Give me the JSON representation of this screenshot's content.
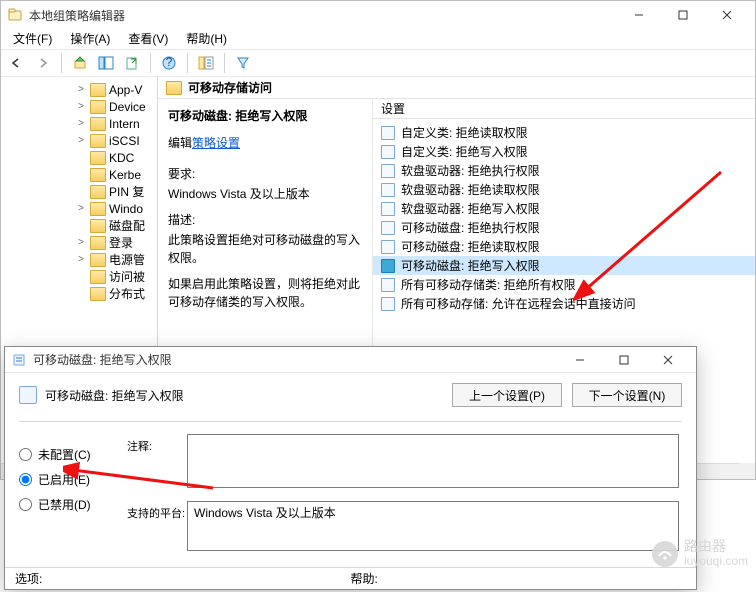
{
  "gpe": {
    "title": "本地组策略编辑器",
    "menu": {
      "file": "文件(F)",
      "action": "操作(A)",
      "view": "查看(V)",
      "help": "帮助(H)"
    },
    "tree": [
      {
        "label": "App-V",
        "caret": ">"
      },
      {
        "label": "Device",
        "caret": ">"
      },
      {
        "label": "Intern",
        "caret": ">"
      },
      {
        "label": "iSCSI",
        "caret": ">"
      },
      {
        "label": "KDC",
        "caret": ""
      },
      {
        "label": "Kerbe",
        "caret": ""
      },
      {
        "label": "PIN 复",
        "caret": ""
      },
      {
        "label": "Windo",
        "caret": ">"
      },
      {
        "label": "磁盘配",
        "caret": ""
      },
      {
        "label": "登录",
        "caret": ">"
      },
      {
        "label": "电源管",
        "caret": ">"
      },
      {
        "label": "访问被",
        "caret": ""
      },
      {
        "label": "分布式",
        "caret": ""
      }
    ],
    "detail": {
      "header": "可移动存储访问",
      "policy_name": "可移动磁盘: 拒绝写入权限",
      "edit_label": "编辑",
      "edit_link": "策略设置",
      "req_label": "要求:",
      "req_value": "Windows Vista 及以上版本",
      "desc_label": "描述:",
      "desc_value": "此策略设置拒绝对可移动磁盘的写入权限。",
      "desc_extra": "如果启用此策略设置，则将拒绝对此可移动存储类的写入权限。",
      "settings_head": "设置",
      "items": [
        {
          "label": "自定义类: 拒绝读取权限"
        },
        {
          "label": "自定义类: 拒绝写入权限"
        },
        {
          "label": "软盘驱动器: 拒绝执行权限"
        },
        {
          "label": "软盘驱动器: 拒绝读取权限"
        },
        {
          "label": "软盘驱动器: 拒绝写入权限"
        },
        {
          "label": "可移动磁盘: 拒绝执行权限"
        },
        {
          "label": "可移动磁盘: 拒绝读取权限"
        },
        {
          "label": "可移动磁盘: 拒绝写入权限",
          "selected": true
        },
        {
          "label": "所有可移动存储类: 拒绝所有权限"
        },
        {
          "label": "所有可移动存储: 允许在远程会话中直接访问"
        }
      ]
    }
  },
  "dlg": {
    "title": "可移动磁盘: 拒绝写入权限",
    "heading": "可移动磁盘: 拒绝写入权限",
    "prev": "上一个设置(P)",
    "next": "下一个设置(N)",
    "radio_unconfigured": "未配置(C)",
    "radio_enabled": "已启用(E)",
    "radio_disabled": "已禁用(D)",
    "comment_label": "注释:",
    "platform_label": "支持的平台:",
    "platform_value": "Windows Vista 及以上版本",
    "bottom_options": "选项:",
    "bottom_help": "帮助:"
  },
  "watermark": {
    "brand": "路由器",
    "domain": "luyouqi.com"
  }
}
